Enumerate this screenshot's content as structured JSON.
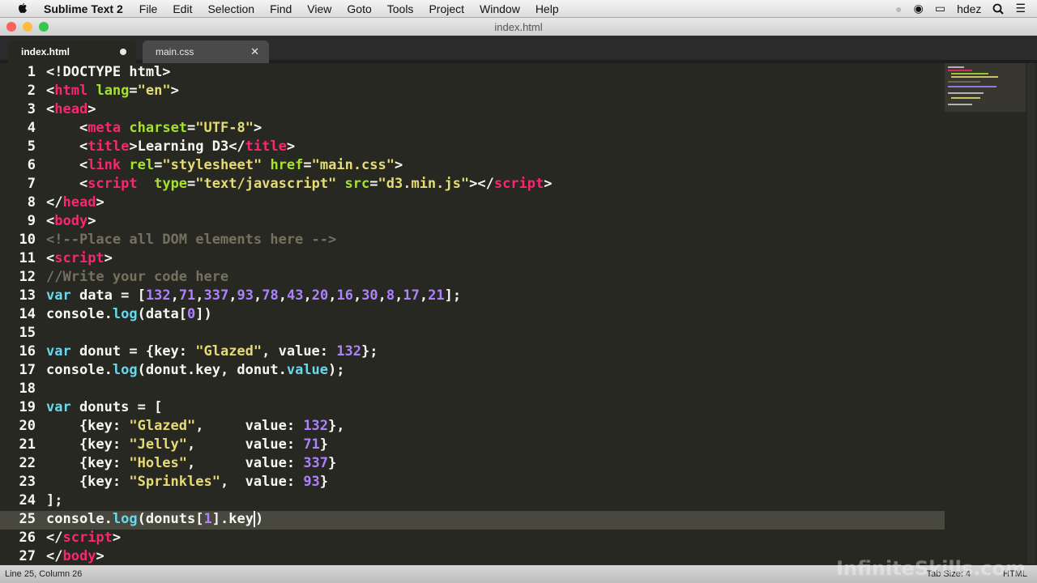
{
  "menubar": {
    "app": "Sublime Text 2",
    "items": [
      "File",
      "Edit",
      "Selection",
      "Find",
      "View",
      "Goto",
      "Tools",
      "Project",
      "Window",
      "Help"
    ],
    "user": "hdez"
  },
  "window": {
    "title": "index.html"
  },
  "tabs": [
    {
      "label": "index.html",
      "state": "modified"
    },
    {
      "label": "main.css",
      "state": "close"
    }
  ],
  "editor": {
    "line_numbers": [
      "1",
      "2",
      "3",
      "4",
      "5",
      "6",
      "7",
      "8",
      "9",
      "10",
      "11",
      "12",
      "13",
      "14",
      "15",
      "16",
      "17",
      "18",
      "19",
      "20",
      "21",
      "22",
      "23",
      "24",
      "25",
      "26",
      "27"
    ],
    "current_line": 25
  },
  "status": {
    "position": "Line 25, Column 26",
    "tab_size": "Tab Size: 4",
    "syntax": "HTML"
  },
  "watermark": "InfiniteSkills.com",
  "colors": {
    "bg": "#272822",
    "tag": "#f92672",
    "attr": "#a6e22e",
    "string": "#e6db74",
    "number": "#ae81ff",
    "keyword": "#66d9ef",
    "comment": "#75715e"
  }
}
